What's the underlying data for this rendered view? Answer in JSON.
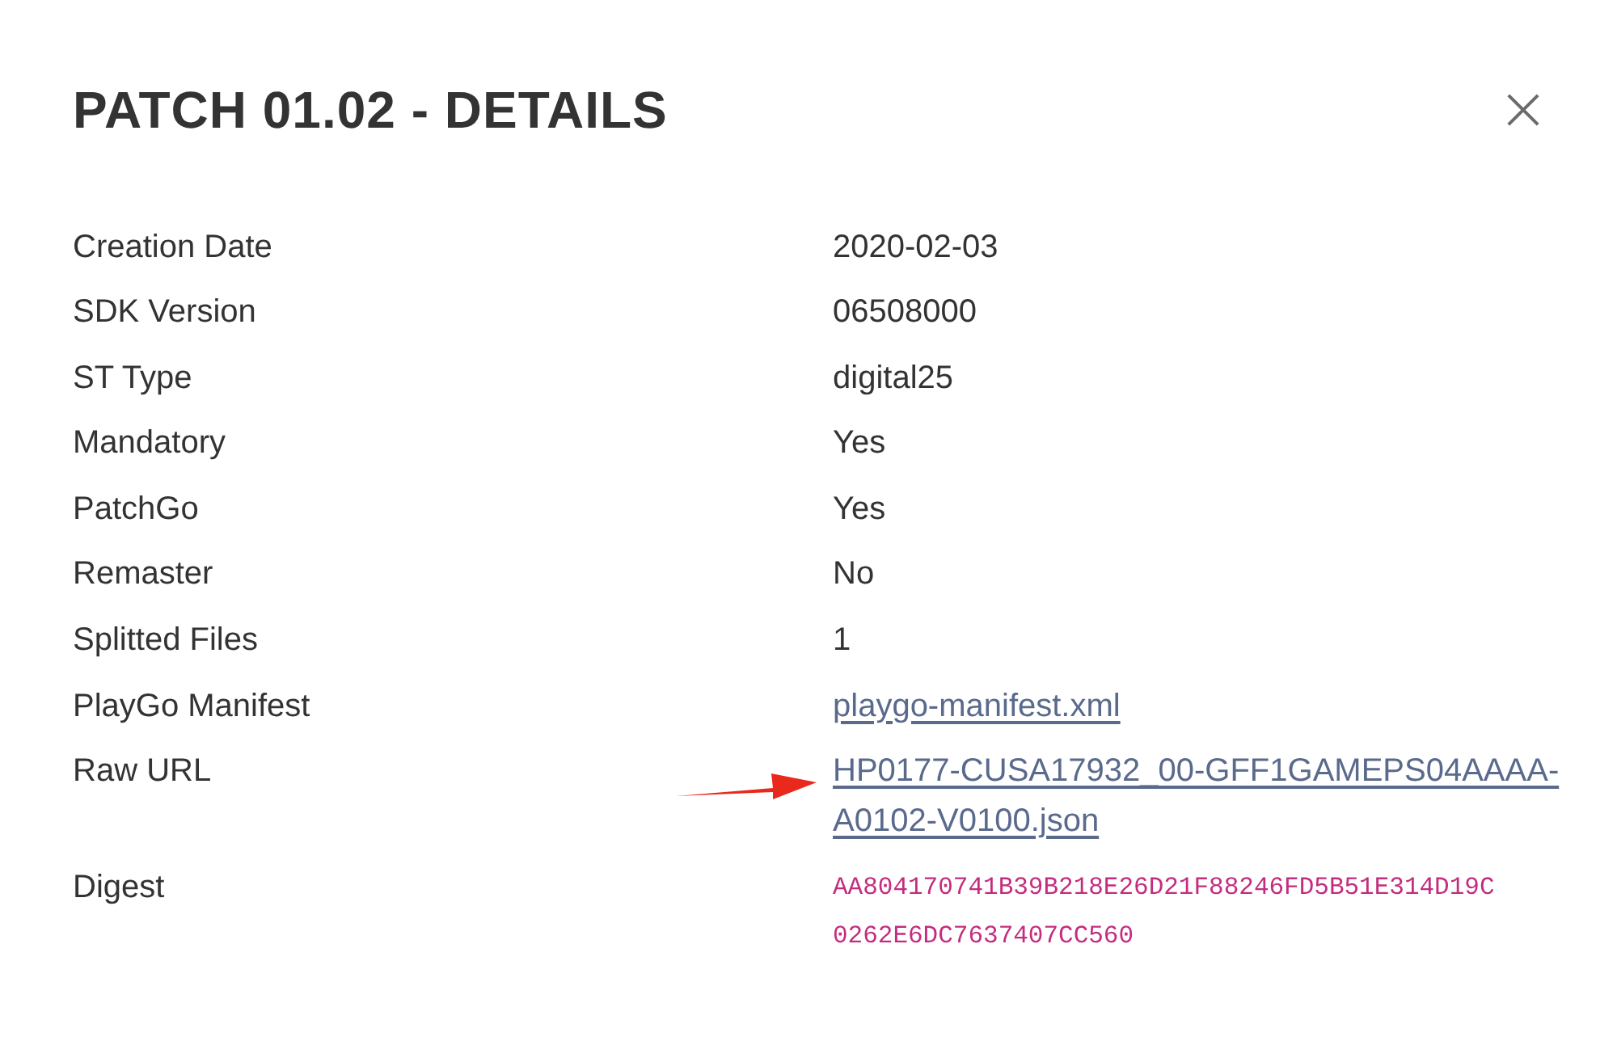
{
  "dialog": {
    "title": "PATCH 01.02 - DETAILS"
  },
  "details": [
    {
      "label": "Creation Date",
      "value": "2020-02-03",
      "kind": "text",
      "annotated": false
    },
    {
      "label": "SDK Version",
      "value": "06508000",
      "kind": "text",
      "annotated": false
    },
    {
      "label": "ST Type",
      "value": "digital25",
      "kind": "text",
      "annotated": false
    },
    {
      "label": "Mandatory",
      "value": "Yes",
      "kind": "text",
      "annotated": false
    },
    {
      "label": "PatchGo",
      "value": "Yes",
      "kind": "text",
      "annotated": false
    },
    {
      "label": "Remaster",
      "value": "No",
      "kind": "text",
      "annotated": false
    },
    {
      "label": "Splitted Files",
      "value": "1",
      "kind": "text",
      "annotated": false
    },
    {
      "label": "PlayGo Manifest",
      "value": "playgo-manifest.xml",
      "kind": "link",
      "annotated": false
    },
    {
      "label": "Raw URL",
      "value": "HP0177-CUSA17932_00-GFF1GAMEPS04AAAA-A0102-V0100.json",
      "kind": "link",
      "annotated": true
    },
    {
      "label": "Digest",
      "value": "AA804170741B39B218E26D21F88246FD5B51E314D19C0262E6DC7637407CC560",
      "kind": "code",
      "annotated": false
    }
  ]
}
